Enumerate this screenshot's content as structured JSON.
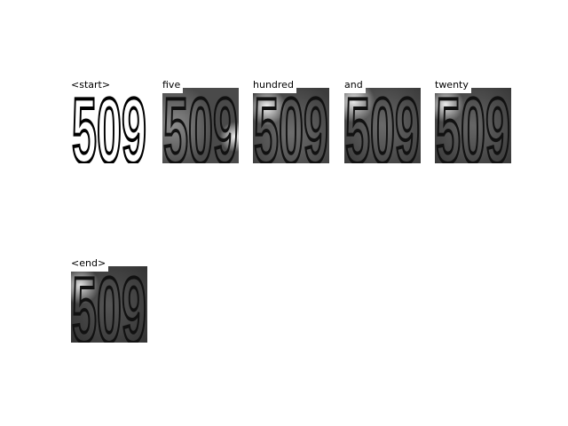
{
  "number_shown": "509",
  "panels": [
    {
      "token": "<start>",
      "type": "original"
    },
    {
      "token": "five",
      "type": "attention"
    },
    {
      "token": "hundred",
      "type": "attention"
    },
    {
      "token": "and",
      "type": "attention"
    },
    {
      "token": "twenty",
      "type": "attention"
    },
    {
      "token": "<end>",
      "type": "attention"
    }
  ]
}
